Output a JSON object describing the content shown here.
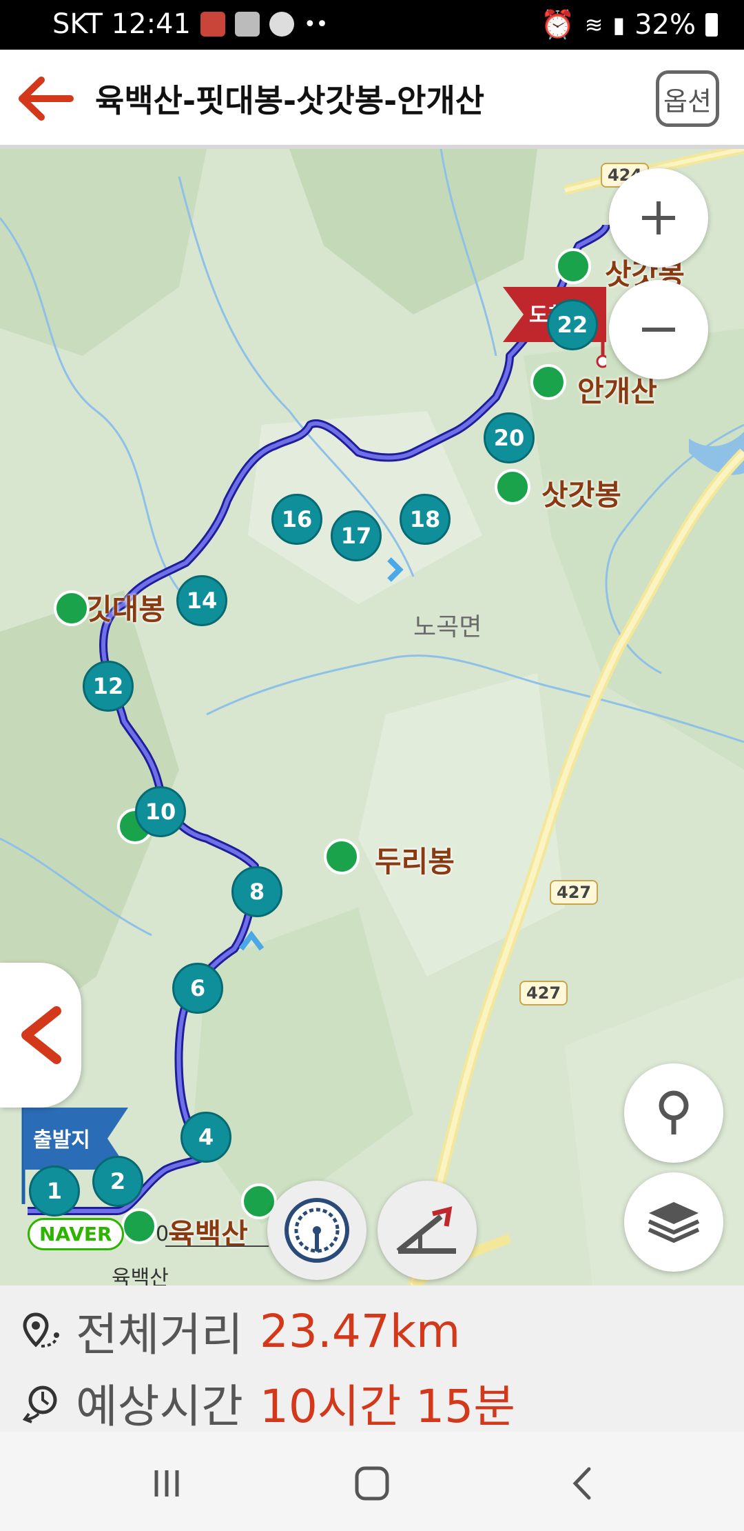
{
  "status_bar": {
    "carrier_time": "SKT 12:41",
    "battery": "32%"
  },
  "header": {
    "title": "육백산-핏대봉-삿갓봉-안개산",
    "option_label": "옵션"
  },
  "map": {
    "peaks": [
      {
        "name": "삿갓봉"
      },
      {
        "name": "안개산"
      },
      {
        "name": "삿갓봉"
      },
      {
        "name": "깃대봉"
      },
      {
        "name": "두리봉"
      },
      {
        "name": "육백산"
      }
    ],
    "region": "노곡면",
    "roads": [
      "424",
      "427",
      "427"
    ],
    "start_flag": "출발지",
    "end_flag": "도착지",
    "waypoints": [
      "1",
      "2",
      "4",
      "6",
      "8",
      "10",
      "12",
      "14",
      "16",
      "17",
      "18",
      "20",
      "22"
    ],
    "bottom_peak_small": "육백산",
    "scale_zero": "0",
    "provider": "NAVER"
  },
  "summary": {
    "distance_label": "전체거리",
    "distance_value": "23.47km",
    "time_label": "예상시간",
    "time_value": "10시간 15분"
  },
  "colors": {
    "accent": "#d4381a",
    "route": "#3a3ad0",
    "marker": "#0f8f9a",
    "peak_green": "#1aa34a"
  }
}
